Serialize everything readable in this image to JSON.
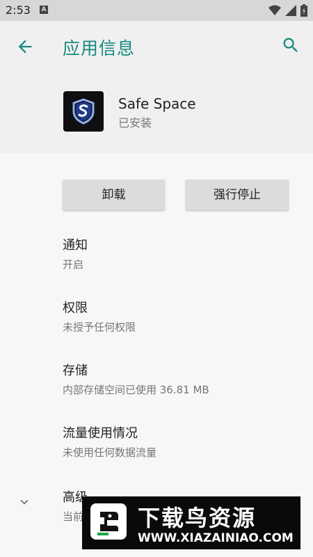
{
  "status_bar": {
    "time": "2:53",
    "a_glyph": "A"
  },
  "app_bar": {
    "title": "应用信息"
  },
  "app": {
    "name": "Safe Space",
    "status": "已安装"
  },
  "buttons": {
    "uninstall": "卸载",
    "force_stop": "强行停止"
  },
  "settings": [
    {
      "title": "通知",
      "subtitle": "开启"
    },
    {
      "title": "权限",
      "subtitle": "未授予任何权限"
    },
    {
      "title": "存储",
      "subtitle": "内部存储空间已使用 36.81 MB"
    },
    {
      "title": "流量使用情况",
      "subtitle": "未使用任何数据流量"
    },
    {
      "title": "高级",
      "subtitle": "当前"
    }
  ],
  "watermark": {
    "title": "下载鸟资源",
    "url": "WWW.XIAZAINIAO.COM"
  },
  "colors": {
    "accent": "#168a80",
    "shield": "#1f3a8a"
  }
}
